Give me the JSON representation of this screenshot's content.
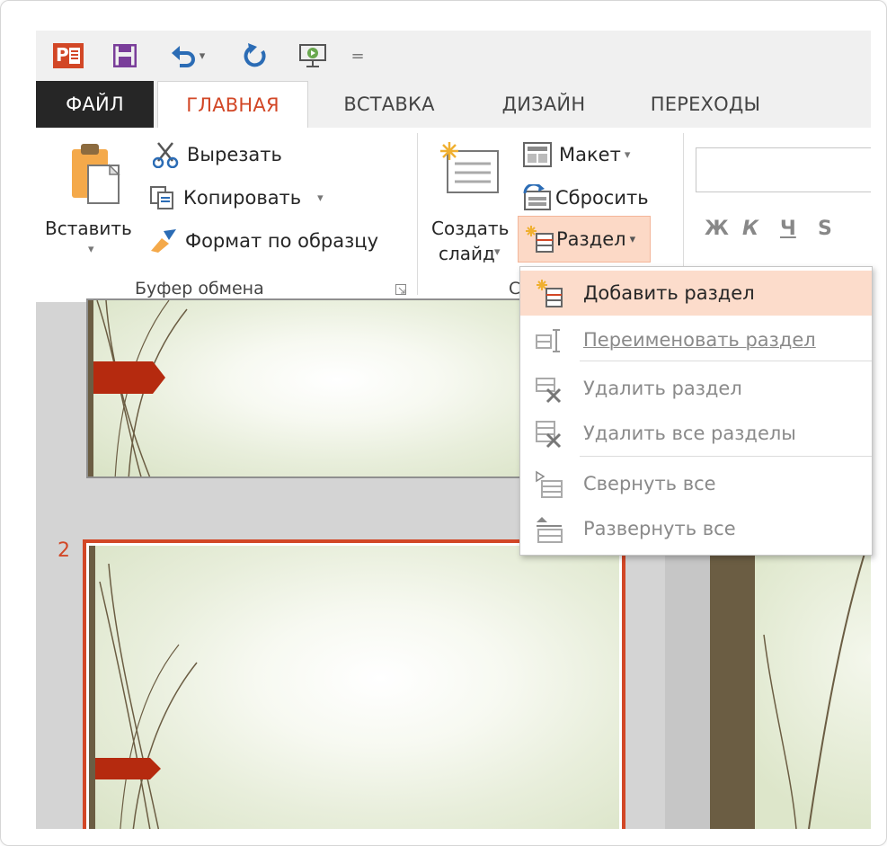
{
  "quick_access": {
    "app_badge": "P",
    "undo_caret": "▾",
    "customize": "="
  },
  "tabs": {
    "file": "ФАЙЛ",
    "home": "ГЛАВНАЯ",
    "insert": "ВСТАВКА",
    "design": "ДИЗАЙН",
    "transitions": "ПЕРЕХОДЫ"
  },
  "clipboard": {
    "paste": "Вставить",
    "cut": "Вырезать",
    "copy": "Копировать",
    "format_painter": "Формат по образцу",
    "group_label": "Буфер обмена"
  },
  "slides_group": {
    "new_slide_line1": "Создать",
    "new_slide_line2": "слайд",
    "layout": "Макет",
    "reset": "Сбросить",
    "section": "Раздел",
    "group_label_partial": "С"
  },
  "font_group": {
    "bold": "Ж",
    "italic": "К",
    "underline": "Ч",
    "strike": "S"
  },
  "thumbnails": {
    "slide2_number": "2"
  },
  "section_menu": {
    "items": [
      {
        "label": "Добавить раздел",
        "state": "active"
      },
      {
        "label": "Переименовать раздел",
        "state": "disabled"
      },
      {
        "label": "Удалить раздел",
        "state": "disabled"
      },
      {
        "label": "Удалить все разделы",
        "state": "disabled"
      },
      {
        "label": "Свернуть все",
        "state": "disabled"
      },
      {
        "label": "Развернуть все",
        "state": "disabled"
      }
    ]
  },
  "colors": {
    "accent": "#d24726",
    "file_tab_bg": "#262626",
    "highlight": "#fcdccb",
    "slide_marker": "#b52a0f",
    "stem": "#6b5d43"
  }
}
